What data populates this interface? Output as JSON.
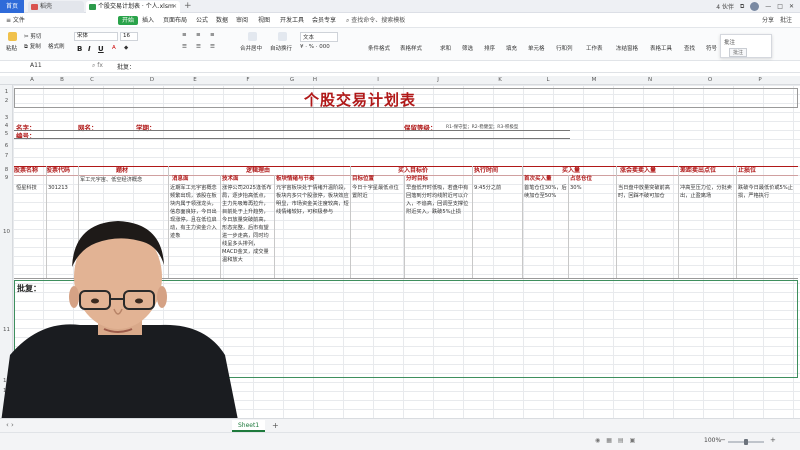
{
  "window": {
    "home_tab": "首页",
    "tabs": [
      {
        "label": "稻壳"
      },
      {
        "label": "个股交易计划表 · 个人.xlsm"
      }
    ],
    "add_tab": "+",
    "right_items": [
      "4 伙伴",
      "⧉"
    ]
  },
  "menu": {
    "file": "≡ 文件",
    "items": [
      "开始",
      "插入",
      "页面布局",
      "公式",
      "数据",
      "审阅",
      "视图",
      "开发工具",
      "会员专享"
    ],
    "search": "查找命令、搜索模板",
    "right": [
      "分享",
      "批注"
    ]
  },
  "ribbon": {
    "paste": "粘贴",
    "cut": "剪切",
    "copy": "复制",
    "format_painter": "格式刷",
    "font_name": "宋体",
    "font_size": "16",
    "bold": "B",
    "italic": "I",
    "underline": "U",
    "merge": "合并居中",
    "wrap": "自动换行",
    "number_format": "文本",
    "tools": [
      "条件格式",
      "表格样式",
      "求和",
      "筛选",
      "排序",
      "填充",
      "单元格",
      "行和列",
      "工作表",
      "冻结窗格",
      "表格工具",
      "查找",
      "符号"
    ],
    "tooltip_title": "批注",
    "tooltip_sub": "批注"
  },
  "formula_bar": {
    "cell_ref": "A11",
    "content": "批复："
  },
  "columns": [
    "A",
    "B",
    "C",
    "D",
    "E",
    "F",
    "G",
    "H",
    "I",
    "J",
    "K",
    "L",
    "M",
    "N",
    "O",
    "P"
  ],
  "rows": [
    "1",
    "2",
    "3",
    "4",
    "5",
    "6",
    "7",
    "8",
    "9",
    "10",
    "11",
    "12",
    "13"
  ],
  "sheet": {
    "title": "个股交易计划表",
    "info": {
      "name_label": "名字：",
      "network_label": "网名：",
      "school_label": "学期：",
      "number_label": "编号：",
      "risk_label": "保留等级：",
      "risk_note": "R1-保守型；R2-稳健型；R3-积极型"
    },
    "headers": [
      "股票名称",
      "股票代码",
      "题材",
      "逻辑理由",
      "买入目标价",
      "执行时间",
      "买入量",
      "涨会卖卖入量",
      "差距卖出点位",
      "止损位"
    ],
    "subheaders": [
      "消息面",
      "技术面",
      "板块情绪与节奏",
      "目标位置",
      "分时目标",
      "首次买入量",
      "占总仓位"
    ],
    "row": {
      "name": "恒星科技",
      "code": "301213",
      "theme": "军工元宇宙、低空经济概念",
      "news": "近期军工元宇宙概念频繁出现，该股在板块内属于领涨龙头，信息面良好，今日出现涨停，且在低位启动，有主力资金介入迹象",
      "technical": "涨停公司2025逢低布局，逐步抬高低点，主力先吸筹再拉升，目前处于上升趋势，今日放量突破前高，形态完整，后市有望进一步走高，同时均线呈多头排列，MACD金叉，成交量温和放大",
      "sector": "元宇宙板块处于情绪升温阶段，板块内多只个股涨停，板块效应明显，市场资金关注度较高，短线情绪较好，可积极参与",
      "target": "今日十字星最低点位置附近",
      "intraday": "早盘低开时低吸，若盘中有回落到分时均线附近可以介入，不追高，回调至支撑位附近买入，跌破5%止损",
      "time": "9:45分之前",
      "first_qty": "首笔仓位30%，后续加仓至50%",
      "position": "30%",
      "add_point": "当日盘中放量突破前高时，回踩不破可加仓",
      "sell_point": "冲高至压力位，分批卖出，止盈离场",
      "stop_loss": "跌破今日最低价或5%止损，严格执行"
    },
    "approve_label": "批复："
  },
  "sheet_tabs": {
    "active": "Sheet1",
    "add": "+"
  },
  "status": {
    "zoom": "100%",
    "zoom_level": 1.0
  }
}
